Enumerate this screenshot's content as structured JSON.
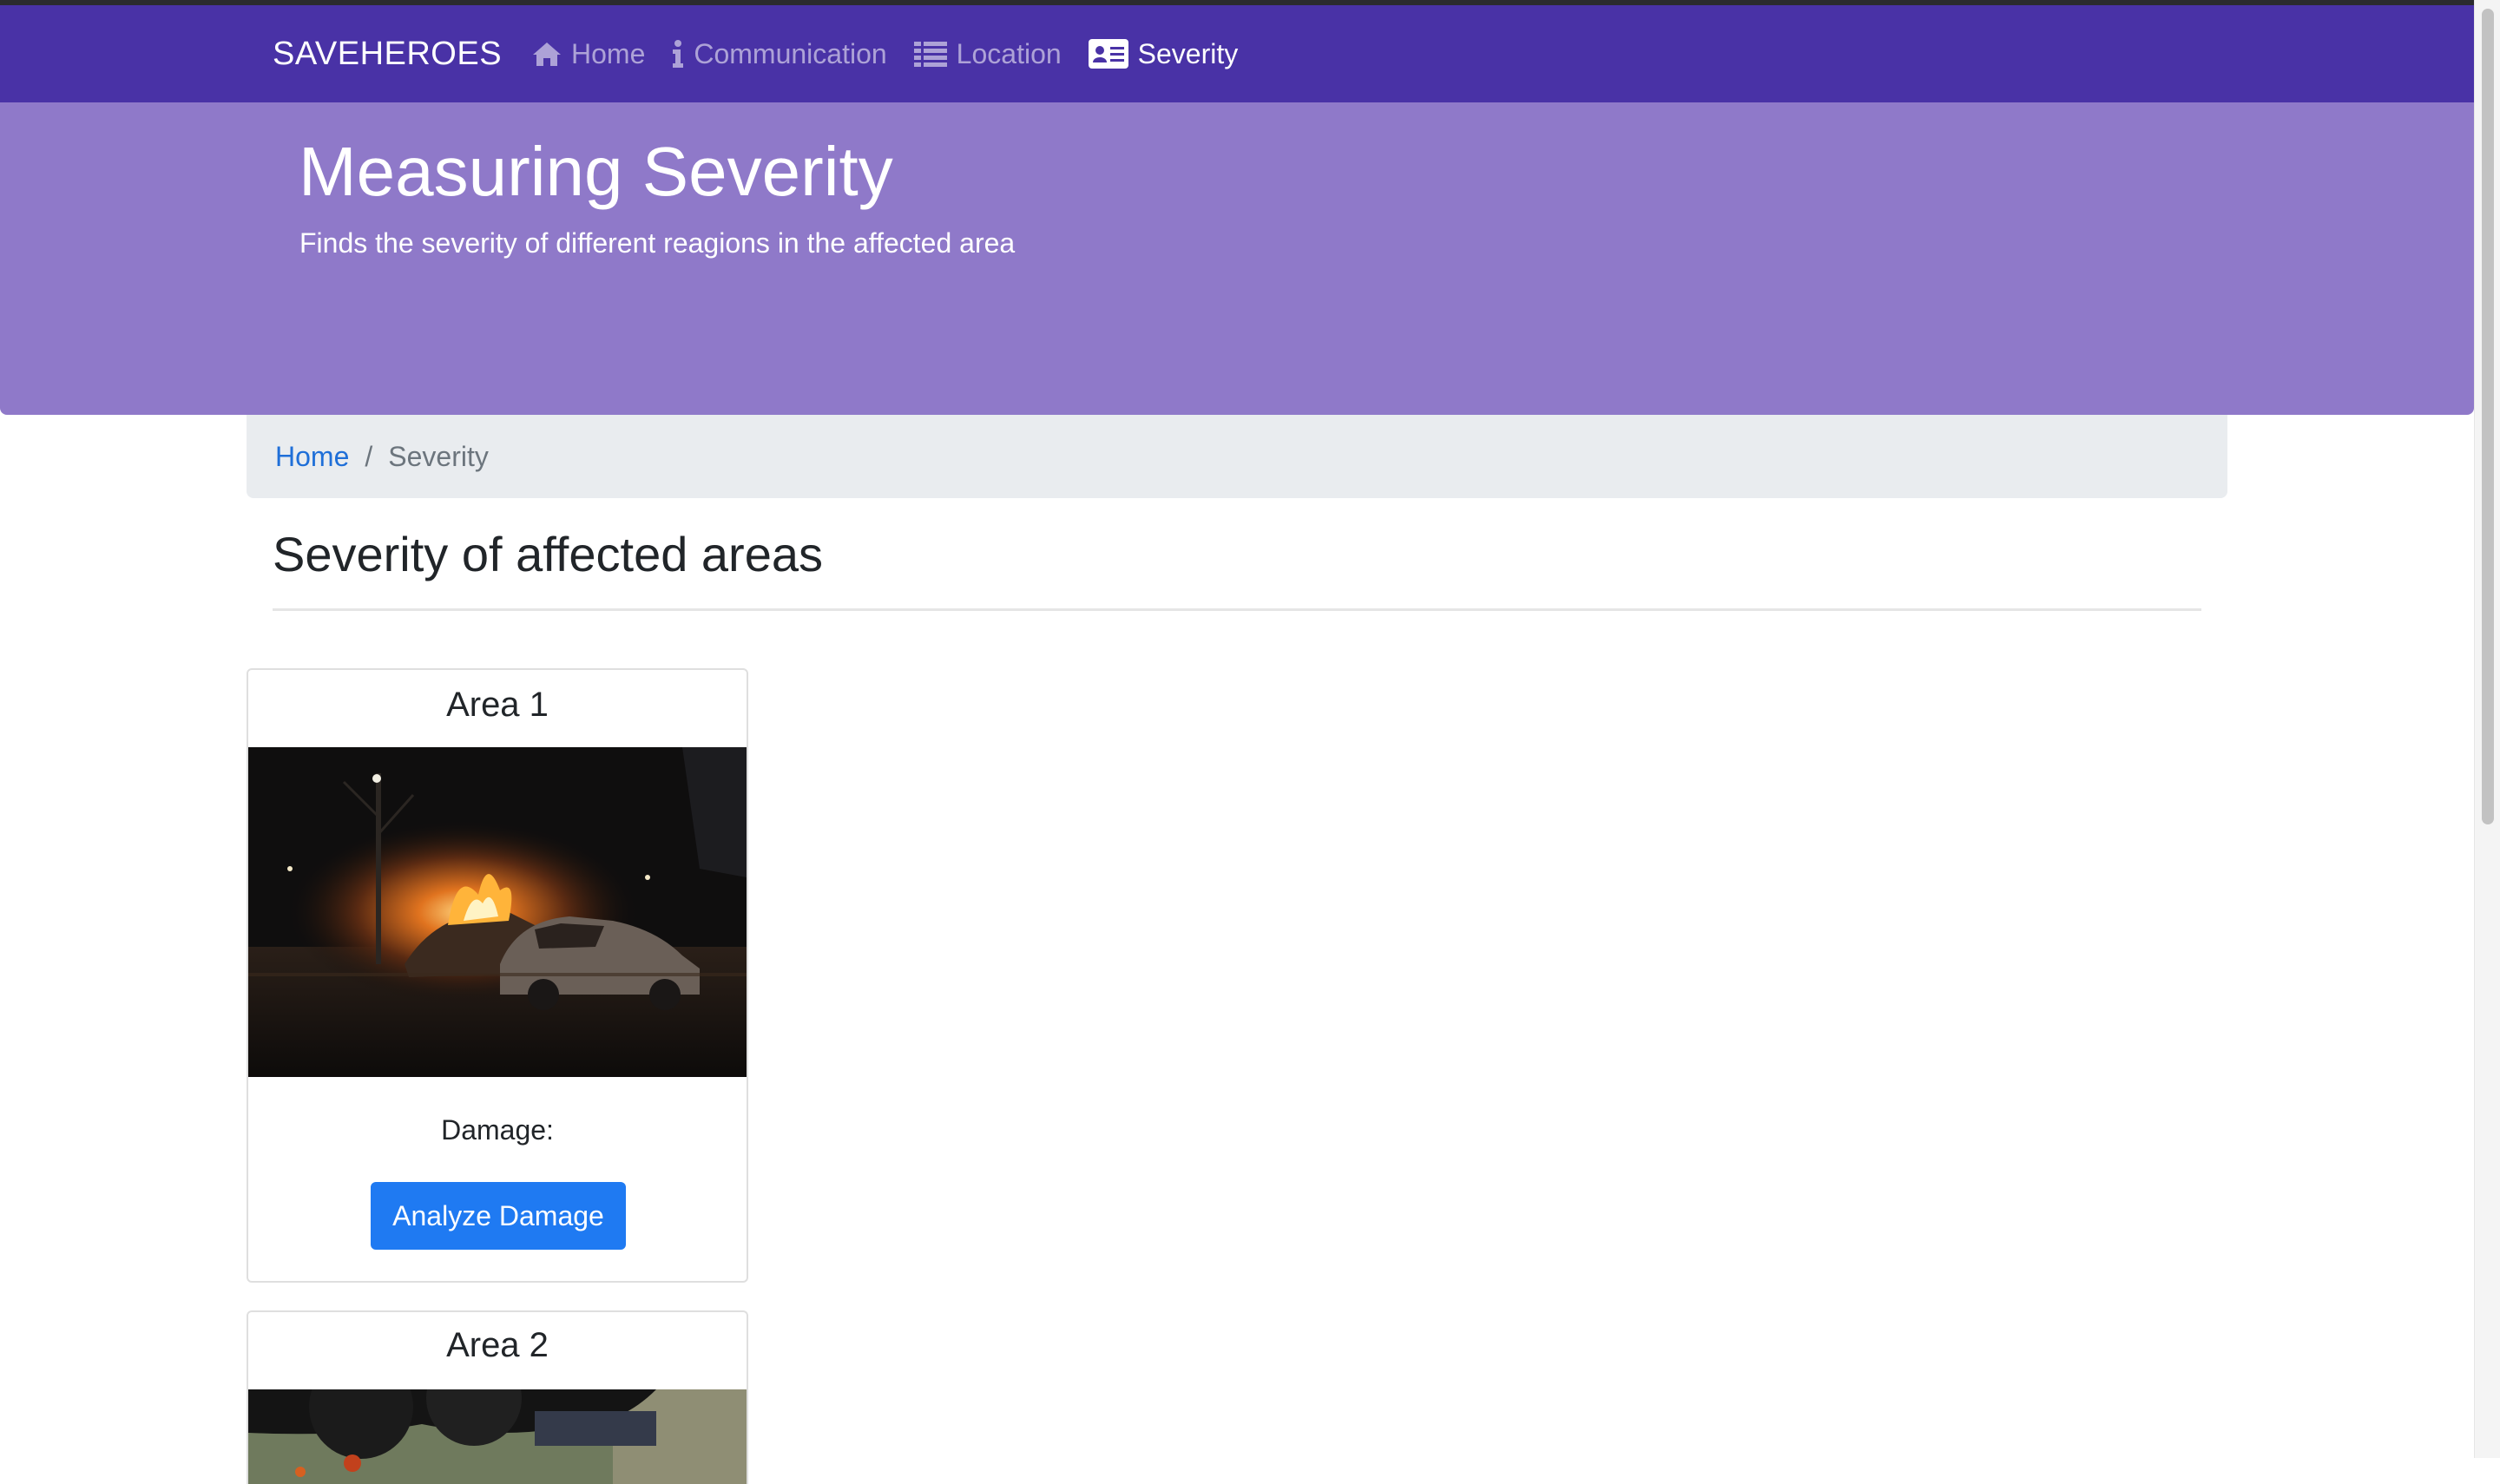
{
  "nav": {
    "brand": "SAVEHEROES",
    "items": [
      {
        "label": "Home",
        "icon": "home-icon",
        "active": false
      },
      {
        "label": "Communication",
        "icon": "info-icon",
        "active": false
      },
      {
        "label": "Location",
        "icon": "list-icon",
        "active": false
      },
      {
        "label": "Severity",
        "icon": "id-card-icon",
        "active": true
      }
    ]
  },
  "hero": {
    "title": "Measuring Severity",
    "subtitle": "Finds the severity of different reagions in the affected area"
  },
  "breadcrumb": {
    "home": "Home",
    "separator": "/",
    "current": "Severity"
  },
  "section": {
    "title": "Severity of affected areas"
  },
  "areas": [
    {
      "title": "Area 1",
      "damage_label": "Damage:",
      "button_label": "Analyze Damage"
    },
    {
      "title": "Area 2"
    }
  ],
  "colors": {
    "navbar": "#4932a6",
    "hero": "#8f79c9",
    "button": "#1f7af2",
    "link": "#1f6fd8"
  }
}
